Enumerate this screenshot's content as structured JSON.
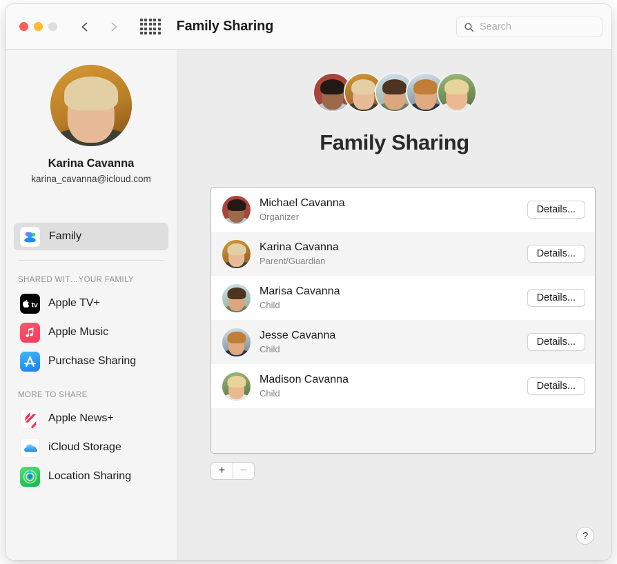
{
  "window": {
    "title": "Family Sharing",
    "traffic_lights": [
      "close",
      "minimize",
      "zoom"
    ],
    "back_icon": "chevron-left-icon",
    "forward_icon": "chevron-right-icon",
    "grid_icon": "show-all-grid-icon"
  },
  "search": {
    "placeholder": "Search",
    "value": "",
    "icon": "search-icon"
  },
  "sidebar": {
    "profile": {
      "avatar": "karina-avatar",
      "name": "Karina Cavanna",
      "email": "karina_cavanna@icloud.com"
    },
    "nav": [
      {
        "label": "Family",
        "icon": "family-group-icon",
        "selected": true
      }
    ],
    "sections": [
      {
        "header": "SHARED WIT…YOUR FAMILY",
        "items": [
          {
            "label": "Apple TV+",
            "icon": "apple-tv-plus-icon"
          },
          {
            "label": "Apple Music",
            "icon": "apple-music-icon"
          },
          {
            "label": "Purchase Sharing",
            "icon": "app-store-icon"
          }
        ]
      },
      {
        "header": "MORE TO SHARE",
        "items": [
          {
            "label": "Apple News+",
            "icon": "apple-news-plus-icon"
          },
          {
            "label": "iCloud Storage",
            "icon": "icloud-icon"
          },
          {
            "label": "Location Sharing",
            "icon": "find-my-icon"
          }
        ]
      }
    ]
  },
  "main": {
    "title": "Family Sharing",
    "avatar_cluster": [
      "michael-avatar",
      "karina-avatar",
      "marisa-avatar",
      "jesse-avatar",
      "madison-avatar"
    ],
    "members": [
      {
        "name": "Michael Cavanna",
        "role": "Organizer",
        "button": "Details...",
        "avatar": "michael-avatar"
      },
      {
        "name": "Karina Cavanna",
        "role": "Parent/Guardian",
        "button": "Details...",
        "avatar": "karina-avatar"
      },
      {
        "name": "Marisa Cavanna",
        "role": "Child",
        "button": "Details...",
        "avatar": "marisa-avatar"
      },
      {
        "name": "Jesse Cavanna",
        "role": "Child",
        "button": "Details...",
        "avatar": "jesse-avatar"
      },
      {
        "name": "Madison Cavanna",
        "role": "Child",
        "button": "Details...",
        "avatar": "madison-avatar"
      }
    ],
    "add_button": "+",
    "remove_button": "−",
    "remove_enabled": false,
    "help_button": "?"
  },
  "colors": {
    "window_bg": "#ececec",
    "sidebar_bg": "#f5f5f5",
    "toolbar_bg": "#fafafa",
    "panel_bg": "#ffffff",
    "row_alt_bg": "#f4f4f4",
    "text_primary": "#1a1a1a",
    "text_secondary": "#858585",
    "traffic_red": "#ff5f57",
    "traffic_yellow": "#febc2e",
    "traffic_gray": "#dededc"
  }
}
